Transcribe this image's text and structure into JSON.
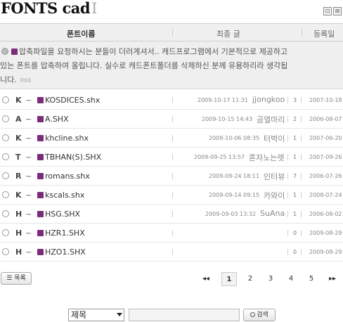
{
  "board": {
    "title": "FONTS cad",
    "title_mark": "I",
    "icons": [
      "rss-icon",
      "admin-icon"
    ]
  },
  "header": {
    "col_name": "폰트이름",
    "col_last": "최종 글",
    "col_reg": "등록일"
  },
  "notice": {
    "line1": "압축파일을 요청하시는 분들이 더러계셔서.. 캐드프로그램에서 기본적으로 제공하고",
    "line2": "있는 폰트를 압축하여 올립니다. 실수로 캐드폰트폴더를 삭제하신 분께 유용하리라 생각됩",
    "line3": "니다.",
    "counter": "R66"
  },
  "rows": [
    {
      "letter": "K",
      "tilde": "~",
      "name": "KOSDICES.shx",
      "date": "2009-10-17 11:31",
      "author": "jjongkoo",
      "count": "3",
      "reg": "2007-10-18"
    },
    {
      "letter": "A",
      "tilde": "~",
      "name": "A.SHX",
      "date": "2009-10-15 14:43",
      "author": "곰열마리",
      "count": "2",
      "reg": "2006-08-07"
    },
    {
      "letter": "K",
      "tilde": "~",
      "name": "khcline.shx",
      "date": "2009-10-06 08:35",
      "author": "터벅이",
      "count": "1",
      "reg": "2007-06-20"
    },
    {
      "letter": "T",
      "tilde": "~",
      "name": "TBHAN(S).SHX",
      "date": "2009-09-25 13:57",
      "author": "혼자노는렛",
      "count": "1",
      "reg": "2007-09-26"
    },
    {
      "letter": "R",
      "tilde": "~",
      "name": "romans.shx",
      "date": "2009-09-24 18:11",
      "author": "인터뷰",
      "count": "7",
      "reg": "2006-07-26"
    },
    {
      "letter": "K",
      "tilde": "~",
      "name": "kscals.shx",
      "date": "2009-09-14 09:15",
      "author": "카와이",
      "count": "1",
      "reg": "2008-07-24"
    },
    {
      "letter": "H",
      "tilde": "~",
      "name": "HSG.SHX",
      "date": "2009-09-03 13:32",
      "author": "SuAna",
      "count": "1",
      "reg": "2006-08-02"
    },
    {
      "letter": "H",
      "tilde": "~",
      "name": "HZR1.SHX",
      "date": "",
      "author": "",
      "count": "0",
      "reg": "2009-08-29"
    },
    {
      "letter": "H",
      "tilde": "~",
      "name": "HZO1.SHX",
      "date": "",
      "author": "",
      "count": "0",
      "reg": "2009-08-29"
    }
  ],
  "footer": {
    "list_label": "목록",
    "pager": {
      "first": "◂◂",
      "pages": [
        "1",
        "2",
        "3",
        "4",
        "5"
      ],
      "current": "1",
      "last": "▸▸"
    }
  },
  "search": {
    "select_value": "제목",
    "input_value": "",
    "button_label": "검색"
  }
}
